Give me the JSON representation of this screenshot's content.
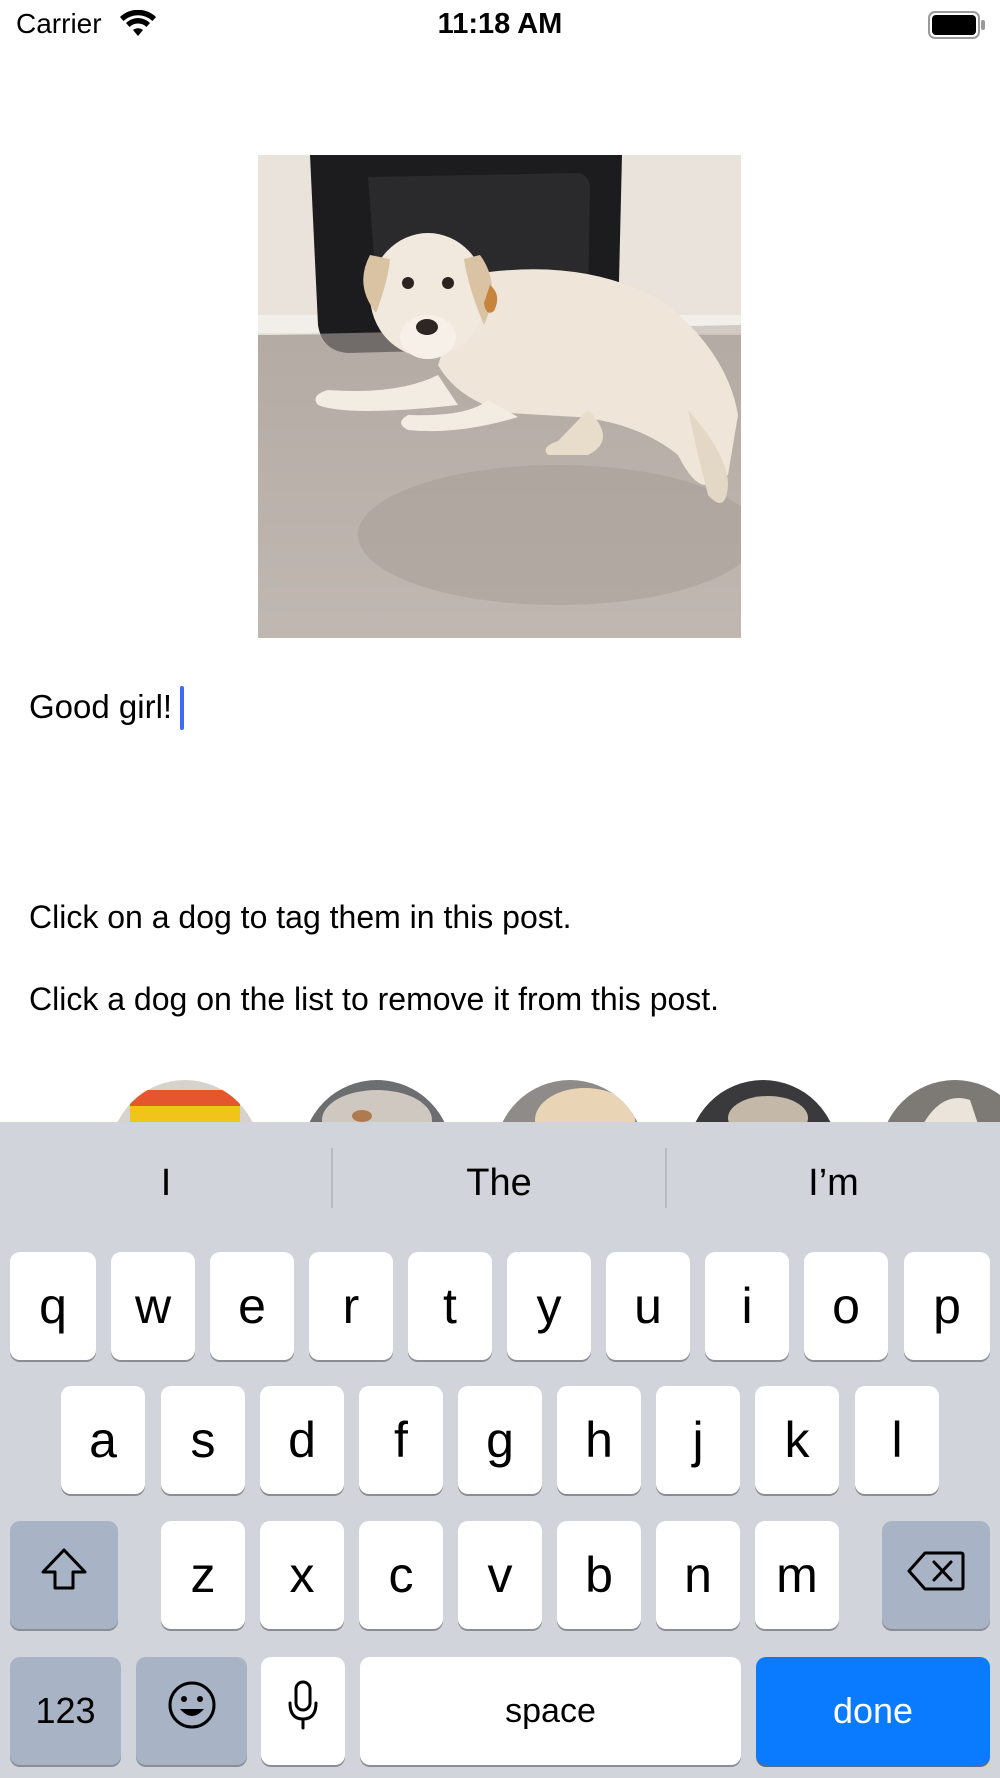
{
  "status_bar": {
    "carrier": "Carrier",
    "time": "11:18 AM"
  },
  "post": {
    "caption": "Good girl!",
    "instruction_tag": "Click on a dog to tag them in this post.",
    "instruction_remove": "Click a dog on the list to remove it from this post."
  },
  "keyboard": {
    "suggestions": [
      "I",
      "The",
      "I’m"
    ],
    "row1": [
      "q",
      "w",
      "e",
      "r",
      "t",
      "y",
      "u",
      "i",
      "o",
      "p"
    ],
    "row2": [
      "a",
      "s",
      "d",
      "f",
      "g",
      "h",
      "j",
      "k",
      "l"
    ],
    "row3": [
      "z",
      "x",
      "c",
      "v",
      "b",
      "n",
      "m"
    ],
    "numbers_label": "123",
    "space_label": "space",
    "done_label": "done"
  },
  "colors": {
    "accent": "#0a7bff",
    "caret": "#3b6cf4",
    "keyboard_bg": "#d1d4db",
    "function_key": "#a8b3c6"
  }
}
